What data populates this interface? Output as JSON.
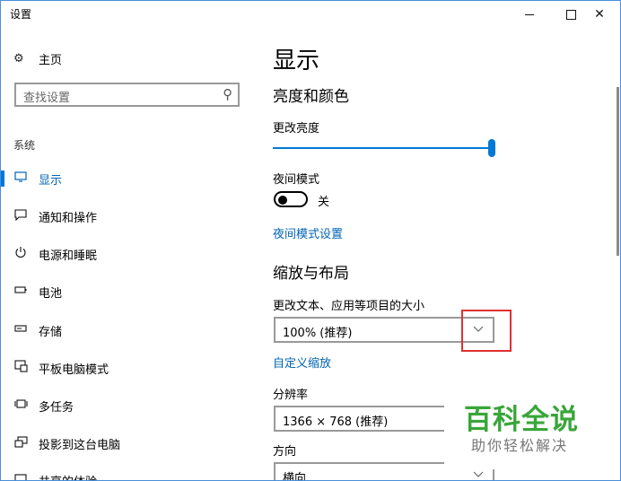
{
  "window": {
    "title": "设置",
    "controls": {
      "minimize": "minimize",
      "maximize": "maximize",
      "close": "✕"
    }
  },
  "sidebar": {
    "home": {
      "icon": "gear-icon",
      "label": "主页"
    },
    "search": {
      "placeholder": "查找设置",
      "icon": "search-icon"
    },
    "group_label": "系统",
    "items": [
      {
        "icon": "monitor-icon",
        "label": "显示",
        "active": true
      },
      {
        "icon": "notification-icon",
        "label": "通知和操作",
        "active": false
      },
      {
        "icon": "power-icon",
        "label": "电源和睡眠",
        "active": false
      },
      {
        "icon": "battery-icon",
        "label": "电池",
        "active": false
      },
      {
        "icon": "storage-icon",
        "label": "存储",
        "active": false
      },
      {
        "icon": "tablet-icon",
        "label": "平板电脑模式",
        "active": false
      },
      {
        "icon": "multitask-icon",
        "label": "多任务",
        "active": false
      },
      {
        "icon": "project-icon",
        "label": "投影到这台电脑",
        "active": false
      },
      {
        "icon": "share-icon",
        "label": "共享的体验",
        "active": false
      }
    ]
  },
  "main": {
    "page_title": "显示",
    "section_brightness": {
      "title": "亮度和颜色",
      "brightness_label": "更改亮度",
      "brightness_level": 1.0,
      "night_mode_label": "夜间模式",
      "night_mode_state": "关",
      "night_mode_link": "夜间模式设置"
    },
    "section_scale": {
      "title": "缩放与布局",
      "scale_label": "更改文本、应用等项目的大小",
      "scale_value": "100% (推荐)",
      "custom_scale_link": "自定义缩放",
      "resolution_label": "分辨率",
      "resolution_value": "1366 × 768 (推荐)",
      "orientation_label": "方向",
      "orientation_value": "横向"
    }
  },
  "watermark": {
    "title": "百科全说",
    "subtitle": "助你轻松解决"
  },
  "colors": {
    "accent": "#0078d7",
    "link": "#0063b1",
    "highlight_box": "#e03030",
    "watermark_green": "#39a63a"
  }
}
